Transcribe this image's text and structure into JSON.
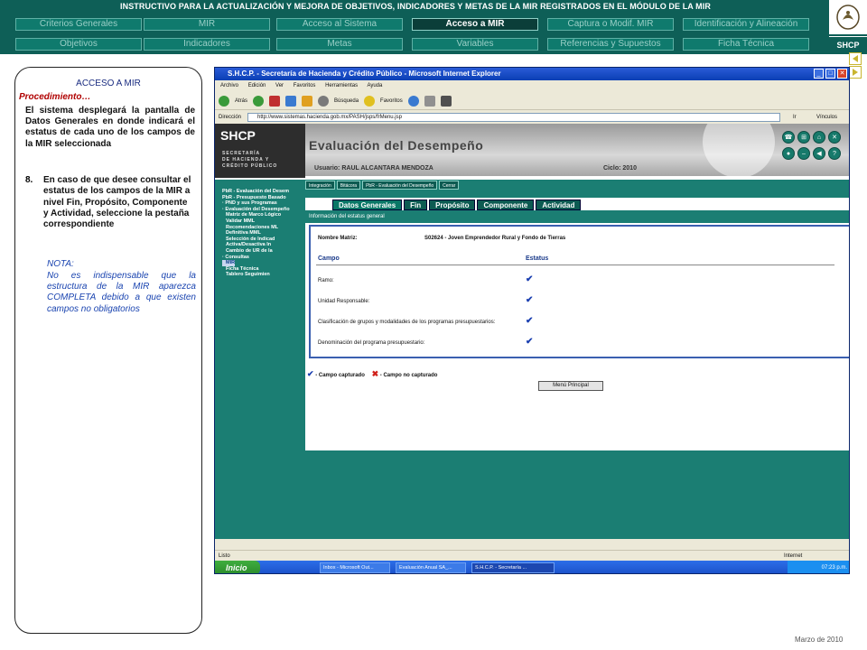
{
  "header": {
    "title": "INSTRUCTIVO PARA LA ACTUALIZACIÓN Y MEJORA DE OBJETIVOS, INDICADORES Y METAS DE LA MIR REGISTRADOS EN EL MÓDULO DE LA MIR",
    "logo_text": "SHCP",
    "nav_row1": [
      "Criterios Generales",
      "MIR",
      "Acceso al Sistema",
      "Acceso a MIR",
      "Captura o Modif. MIR",
      "Identificación y Alineación"
    ],
    "nav_row2": [
      "Objetivos",
      "Indicadores",
      "Metas",
      "Variables",
      "Referencias y Supuestos",
      "Ficha Técnica"
    ],
    "active_tab": "Acceso a MIR"
  },
  "left_panel": {
    "title": "ACCESO A MIR",
    "procedure": "Procedimiento…",
    "intro": "El sistema desplegará la pantalla de Datos Generales en donde indicará el estatus de cada uno de los campos de la MIR seleccionada",
    "step_number": "8.",
    "step_text": "En caso de que desee consultar el estatus de los campos de la MIR a nivel Fin, Propósito, Componente y Actividad, seleccione la pestaña correspondiente",
    "note_title": "NOTA:",
    "note_text": "No es indispensable que la estructura de la MIR aparezca COMPLETA debido a que existen campos no obligatorios"
  },
  "browser": {
    "title": "S.H.C.P. - Secretaría de Hacienda y Crédito Público - Microsoft Internet Explorer",
    "menu": [
      "Archivo",
      "Edición",
      "Ver",
      "Favoritos",
      "Herramientas",
      "Ayuda"
    ],
    "toolbar_back": "Atrás",
    "toolbar_search": "Búsqueda",
    "toolbar_favorites": "Favoritos",
    "address_label": "Dirección",
    "address_value": "http://www.sistemas.hacienda.gob.mx/PASH/jsps/frMenu.jsp",
    "go_label": "Ir",
    "links_label": "Vínculos",
    "status_left": "Listo",
    "status_right": "Internet"
  },
  "app": {
    "shcp_word": "SHCP",
    "shcp_sub": "SECRETARÍA\nDE HACIENDA Y\nCRÉDITO PÚBLICO",
    "page_title": "Evaluación del Desempeño",
    "user": "Usuario: RAUL ALCANTARA MENDOZA",
    "cycle": "Ciclo: 2010",
    "sub_tabs": [
      "Integración",
      "Bitácora",
      "PbR - Evaluación del Desempeño",
      "Cerrar"
    ],
    "sidebar": [
      "PbR - Evaluación del Desem",
      "PbR - Presupuesto Basado",
      "· PND y sus Programas",
      "· Evaluación del Desempeño",
      "  Matriz de Marco Lógico",
      "  Validar MML",
      "  Recomendaciones ML",
      "  Definitiva MML",
      "  Selección de Indicad",
      "  Activa/Desactiva In",
      "  Cambio de UR de la",
      "· Consultas",
      "  MIR",
      "  Ficha Técnica",
      "  Tablero Seguimien"
    ],
    "content_tabs": [
      "Datos Generales",
      "Fin",
      "Propósito",
      "Componente",
      "Actividad"
    ],
    "section_title": "Información del estatus general",
    "matrix_label": "Nombre Matriz:",
    "matrix_value": "S02624 - Joven Emprendedor Rural y Fondo de Tierras",
    "col_campo": "Campo",
    "col_estatus": "Estatus",
    "fields": [
      "Ramo:",
      "Unidad Responsable:",
      "Clasificación de grupos y modalidades de los programas presupuestarios:",
      "Denominación del programa presupuestario:"
    ],
    "legend_captured": "- Campo capturado",
    "legend_not_captured": "- Campo no capturado",
    "menu_button": "Menú Principal"
  },
  "taskbar": {
    "start": "Inicio",
    "items": [
      "Inbox - Microsoft Out...",
      "Evaluación Anual SA_...",
      "S.H.C.P. - Secretaría ..."
    ],
    "time": "07:23 p.m."
  },
  "footer": {
    "date": "Marzo de 2010"
  },
  "colors": {
    "brand_green": "#0e5f57",
    "accent_green": "#1b7e73",
    "check_blue": "#1a3fb0",
    "cross_red": "#d0201a"
  }
}
